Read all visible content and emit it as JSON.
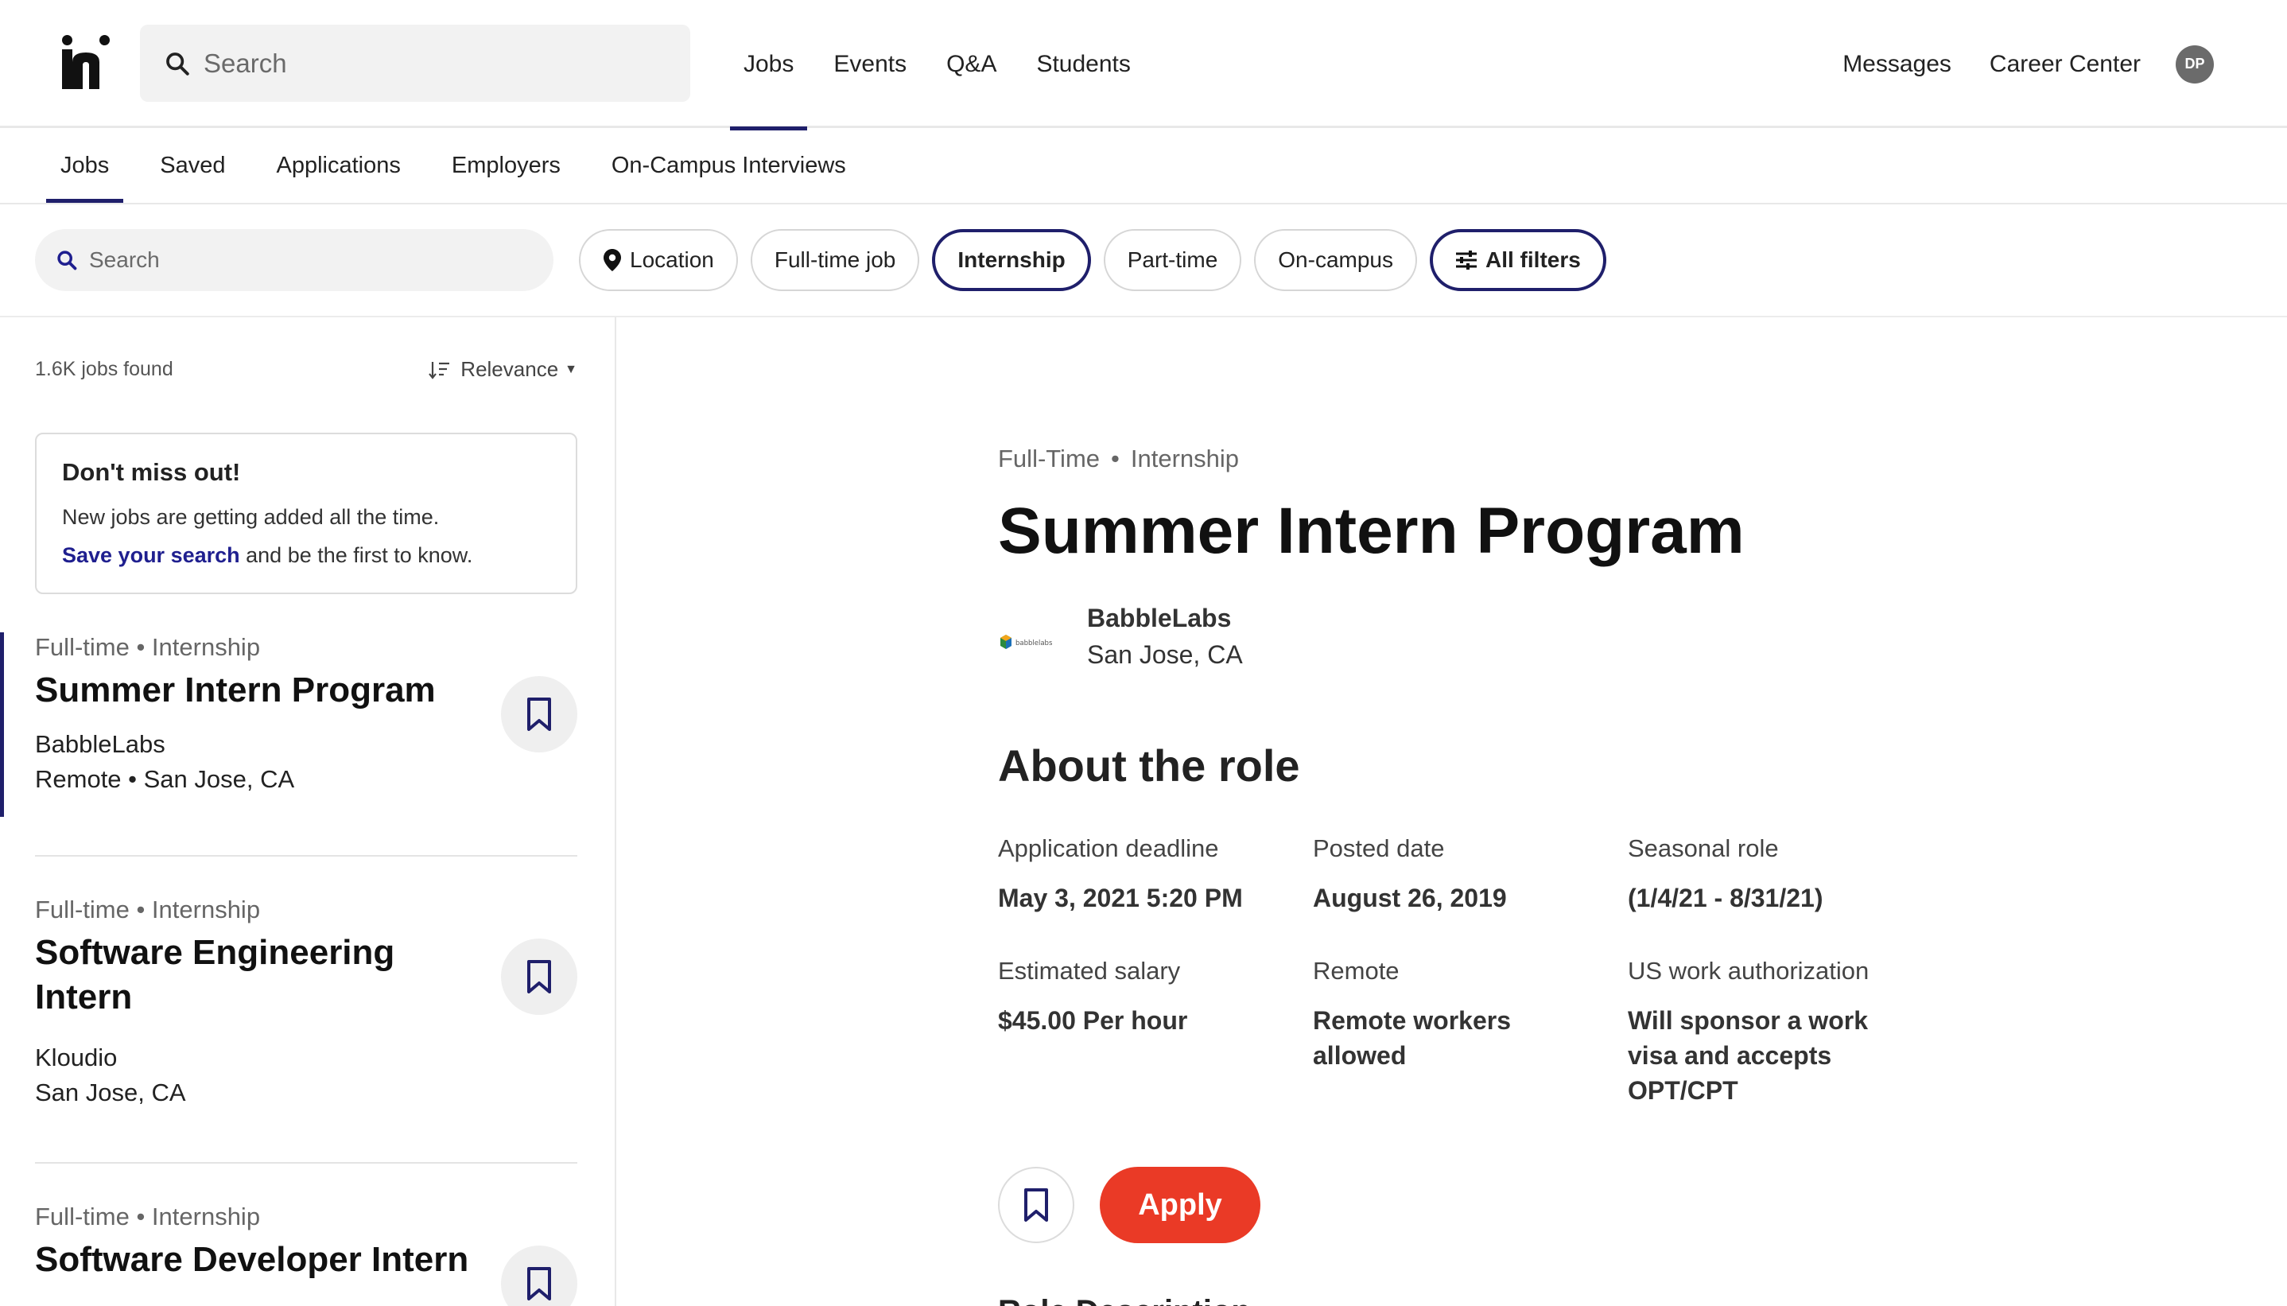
{
  "app": {
    "logo_letter": "h"
  },
  "top_search": {
    "placeholder": "Search"
  },
  "top_nav": [
    {
      "label": "Jobs",
      "active": true
    },
    {
      "label": "Events"
    },
    {
      "label": "Q&A"
    },
    {
      "label": "Students"
    }
  ],
  "top_right": {
    "messages": "Messages",
    "career_center": "Career Center",
    "avatar_initials": "DP"
  },
  "sub_nav": [
    {
      "label": "Jobs",
      "active": true
    },
    {
      "label": "Saved"
    },
    {
      "label": "Applications"
    },
    {
      "label": "Employers"
    },
    {
      "label": "On-Campus Interviews"
    }
  ],
  "filters": {
    "search_placeholder": "Search",
    "chips": {
      "location": "Location",
      "fulltime": "Full-time job",
      "internship": "Internship",
      "parttime": "Part-time",
      "oncampus": "On-campus",
      "allfilters": "All filters"
    },
    "selected": [
      "Internship",
      "All filters"
    ]
  },
  "results": {
    "count": "1.6K jobs found",
    "sort_label": "Relevance"
  },
  "promo": {
    "title": "Don't miss out!",
    "line1": "New jobs are getting added all the time.",
    "link": "Save your search",
    "line2_rest": " and be the first to know."
  },
  "job_cards": [
    {
      "meta": "Full-time • Internship",
      "title": "Summer Intern Program",
      "company": "BabbleLabs",
      "location": "Remote • San Jose, CA",
      "active": true
    },
    {
      "meta": "Full-time • Internship",
      "title": "Software Engineering Intern",
      "company": "Kloudio",
      "location": "San Jose, CA"
    },
    {
      "meta": "Full-time • Internship",
      "title": "Software Developer Intern"
    }
  ],
  "detail": {
    "meta_type": "Full-Time",
    "meta_dot": "•",
    "meta_kind": "Internship",
    "title": "Summer Intern Program",
    "company": "BabbleLabs",
    "location": "San Jose, CA",
    "logo_text": "babblelabs",
    "about_heading": "About the role",
    "facts": {
      "deadline": {
        "label": "Application deadline",
        "value": "May 3, 2021 5:20 PM"
      },
      "posted": {
        "label": "Posted date",
        "value": "August 26, 2019"
      },
      "seasonal": {
        "label": "Seasonal role",
        "value": "(1/4/21 - 8/31/21)"
      },
      "salary": {
        "label": "Estimated salary",
        "value": "$45.00 Per hour"
      },
      "remote": {
        "label": "Remote",
        "value": "Remote workers allowed"
      },
      "auth": {
        "label": "US work authorization",
        "value": "Will sponsor a work visa and accepts OPT/CPT"
      }
    },
    "apply_label": "Apply",
    "next_heading": "Role Description"
  },
  "colors": {
    "accent": "#1f1f6b",
    "apply": "#ea3a26",
    "link": "#1f1f8f"
  }
}
